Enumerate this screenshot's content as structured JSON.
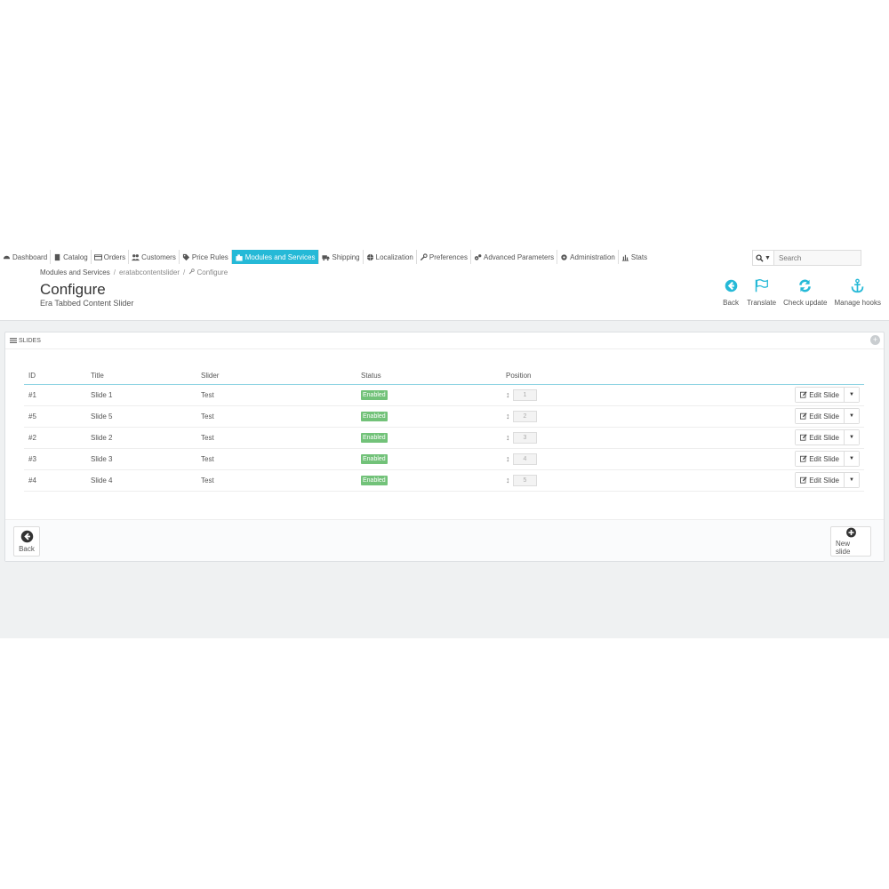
{
  "nav": {
    "items": [
      {
        "label": "Dashboard",
        "icon": "dashboard-icon"
      },
      {
        "label": "Catalog",
        "icon": "book-icon"
      },
      {
        "label": "Orders",
        "icon": "credit-card-icon"
      },
      {
        "label": "Customers",
        "icon": "users-icon"
      },
      {
        "label": "Price Rules",
        "icon": "tags-icon"
      },
      {
        "label": "Modules and Services",
        "icon": "puzzle-icon"
      },
      {
        "label": "Shipping",
        "icon": "truck-icon"
      },
      {
        "label": "Localization",
        "icon": "globe-icon"
      },
      {
        "label": "Preferences",
        "icon": "wrench-icon"
      },
      {
        "label": "Advanced Parameters",
        "icon": "cogs-icon"
      },
      {
        "label": "Administration",
        "icon": "cog-icon"
      },
      {
        "label": "Stats",
        "icon": "bar-chart-icon"
      }
    ],
    "active": "Modules and Services",
    "active_color": "#25b9d7"
  },
  "search": {
    "placeholder": "Search",
    "button_icon": "search-icon"
  },
  "breadcrumb": {
    "items": [
      "Modules and Services",
      "eratabcontentslider",
      "Configure"
    ]
  },
  "header": {
    "title": "Configure",
    "subtitle": "Era Tabbed Content Slider"
  },
  "toolbar": {
    "back": "Back",
    "translate": "Translate",
    "check_update": "Check update",
    "manage_hooks": "Manage hooks",
    "icon_color": "#25b9d7"
  },
  "panel": {
    "title": "Slides",
    "columns": {
      "id": "ID",
      "title": "Title",
      "slider": "Slider",
      "status": "Status",
      "position": "Position"
    },
    "rows": [
      {
        "id": "#1",
        "title": "Slide 1",
        "slider": "Test",
        "status": "Enabled",
        "position": "1",
        "action": "Edit Slide"
      },
      {
        "id": "#5",
        "title": "Slide 5",
        "slider": "Test",
        "status": "Enabled",
        "position": "2",
        "action": "Edit Slide"
      },
      {
        "id": "#2",
        "title": "Slide 2",
        "slider": "Test",
        "status": "Enabled",
        "position": "3",
        "action": "Edit Slide"
      },
      {
        "id": "#3",
        "title": "Slide 3",
        "slider": "Test",
        "status": "Enabled",
        "position": "4",
        "action": "Edit Slide"
      },
      {
        "id": "#4",
        "title": "Slide 4",
        "slider": "Test",
        "status": "Enabled",
        "position": "5",
        "action": "Edit Slide"
      }
    ],
    "status_color": "#72c279",
    "footer": {
      "back": "Back",
      "new_slide": "New slide"
    }
  }
}
